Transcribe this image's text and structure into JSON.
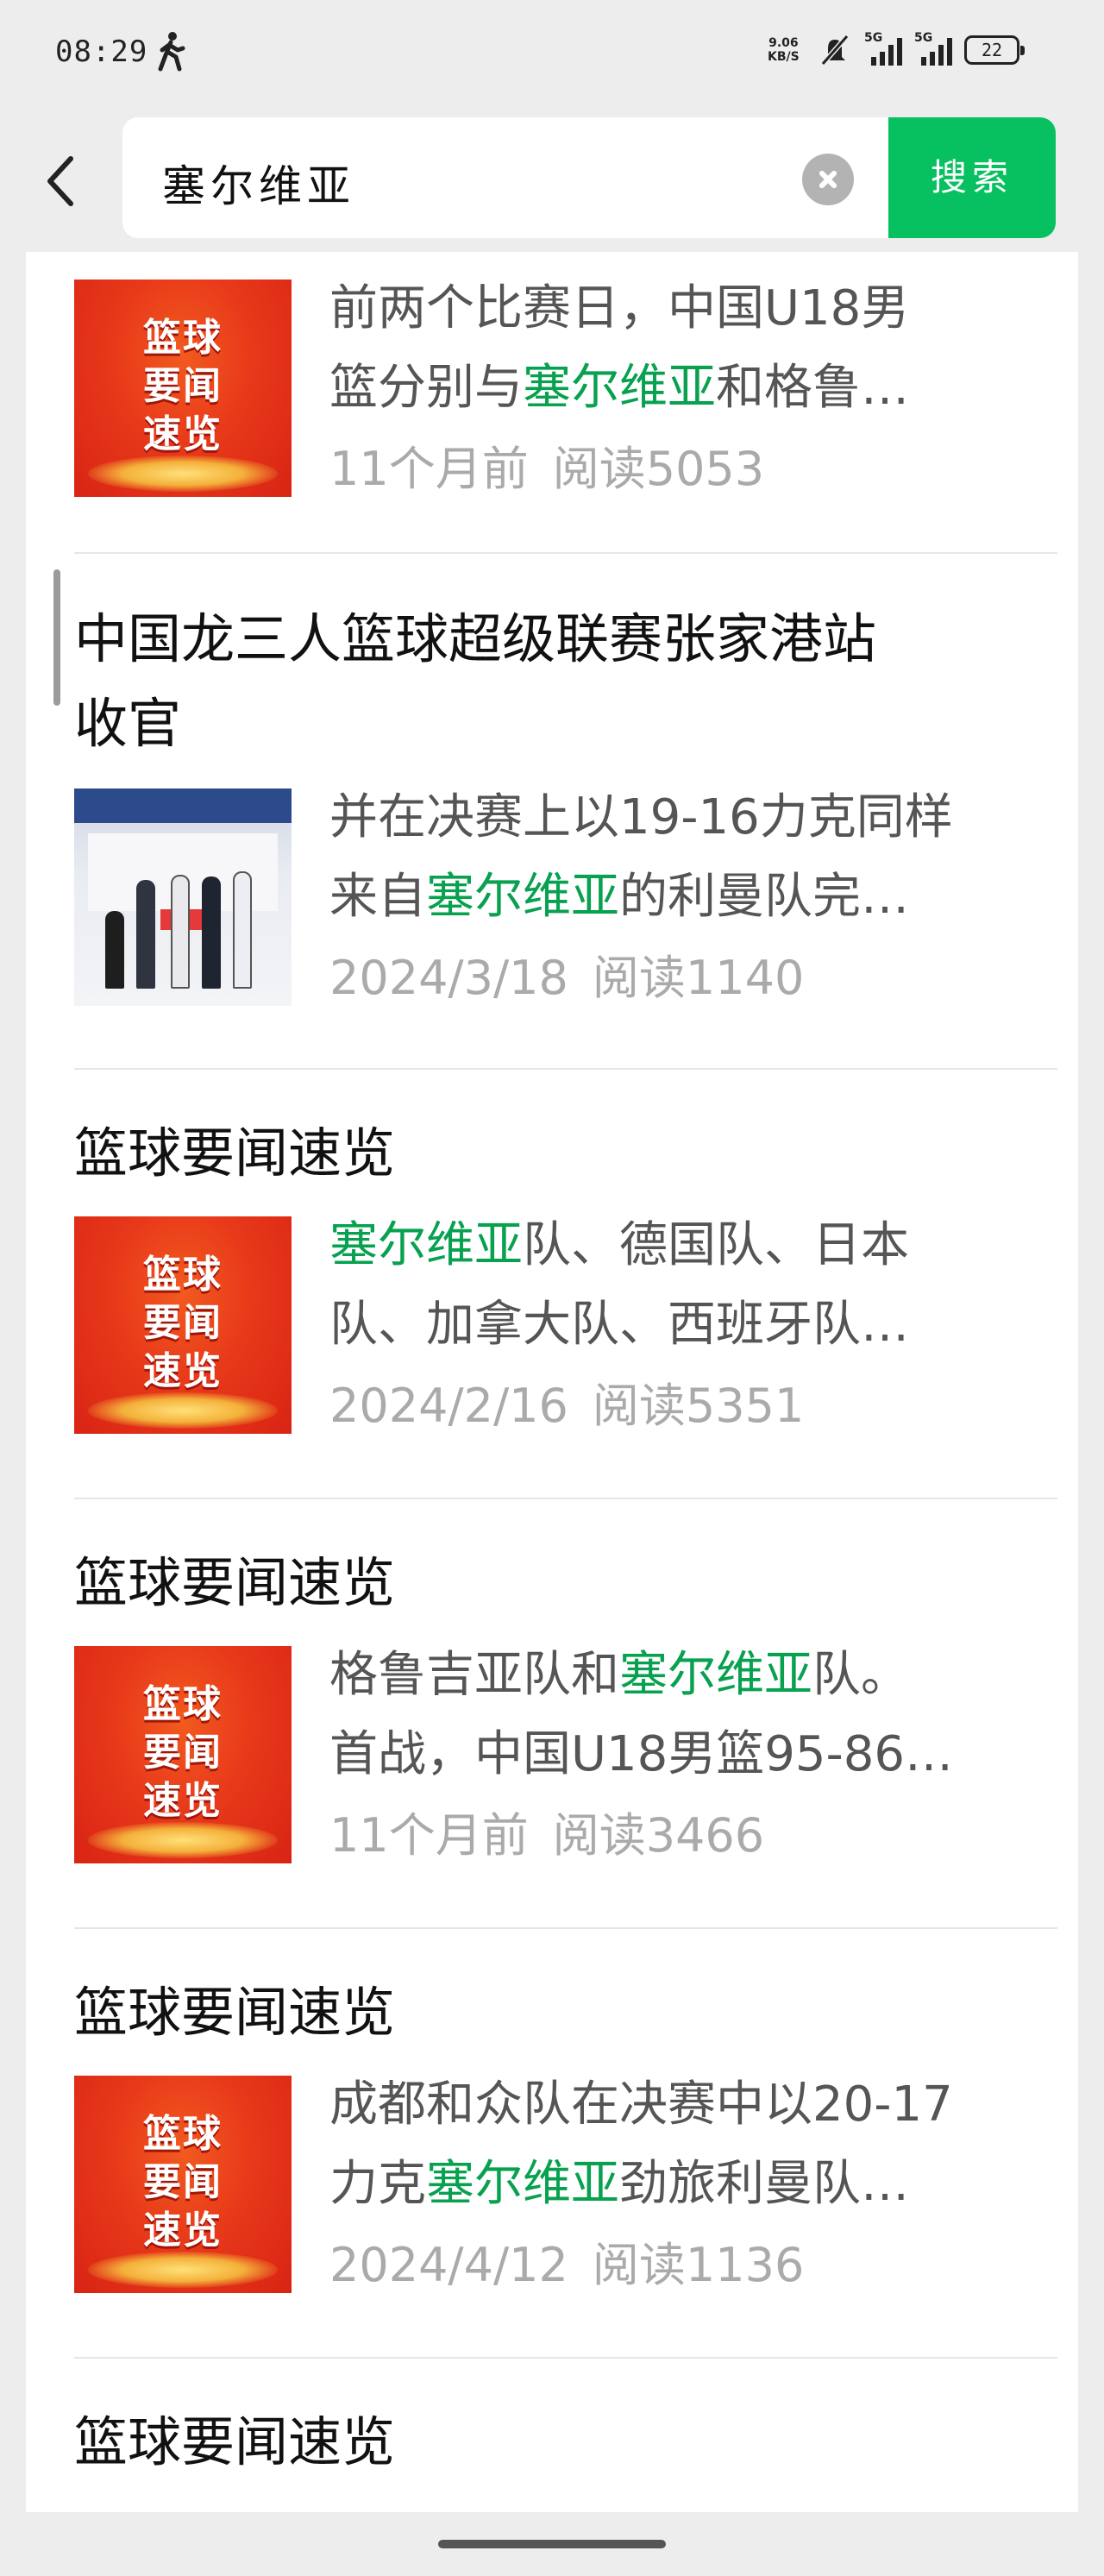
{
  "status_bar": {
    "time": "08:29",
    "net_speed_value": "9.06",
    "net_speed_unit": "KB/S",
    "signal1_label": "5G",
    "signal2_label": "5G",
    "battery": "22"
  },
  "search": {
    "query": "塞尔维亚",
    "button_label": "搜索"
  },
  "colors": {
    "accent": "#07c160",
    "highlight": "#07a14f",
    "thumb_red": "#e8391a"
  },
  "results": [
    {
      "title": "",
      "thumb_type": "red",
      "thumb_lines": [
        "篮球",
        "要闻",
        "速览"
      ],
      "desc_line1": [
        {
          "text": "前两个比赛日，中国U18男",
          "hl": false
        }
      ],
      "desc_line2": [
        {
          "text": "篮分别与",
          "hl": false
        },
        {
          "text": "塞尔维亚",
          "hl": true
        },
        {
          "text": "和格鲁…",
          "hl": false
        }
      ],
      "date": "11个月前",
      "reads": "阅读5053"
    },
    {
      "title_line1": "中国龙三人篮球超级联赛张家港站",
      "title_line2": "收官",
      "thumb_type": "photo",
      "desc_line1": [
        {
          "text": "并在决赛上以19-16力克同样",
          "hl": false
        }
      ],
      "desc_line2": [
        {
          "text": "来自",
          "hl": false
        },
        {
          "text": "塞尔维亚",
          "hl": true
        },
        {
          "text": "的利曼队完…",
          "hl": false
        }
      ],
      "date": "2024/3/18",
      "reads": "阅读1140"
    },
    {
      "title": "篮球要闻速览",
      "thumb_type": "red",
      "thumb_lines": [
        "篮球",
        "要闻",
        "速览"
      ],
      "desc_line1": [
        {
          "text": "塞尔维亚",
          "hl": true
        },
        {
          "text": "队、德国队、日本",
          "hl": false
        }
      ],
      "desc_line2": [
        {
          "text": "队、加拿大队、西班牙队…",
          "hl": false
        }
      ],
      "date": "2024/2/16",
      "reads": "阅读5351"
    },
    {
      "title": "篮球要闻速览",
      "thumb_type": "red",
      "thumb_lines": [
        "篮球",
        "要闻",
        "速览"
      ],
      "desc_line1": [
        {
          "text": "格鲁吉亚队和",
          "hl": false
        },
        {
          "text": "塞尔维亚",
          "hl": true
        },
        {
          "text": "队。",
          "hl": false
        }
      ],
      "desc_line2": [
        {
          "text": "首战，中国U18男篮95-86…",
          "hl": false
        }
      ],
      "date": "11个月前",
      "reads": "阅读3466"
    },
    {
      "title": "篮球要闻速览",
      "thumb_type": "red",
      "thumb_lines": [
        "篮球",
        "要闻",
        "速览"
      ],
      "desc_line1": [
        {
          "text": "成都和众队在决赛中以20-17",
          "hl": false
        }
      ],
      "desc_line2": [
        {
          "text": "力克",
          "hl": false
        },
        {
          "text": "塞尔维亚",
          "hl": true
        },
        {
          "text": "劲旅利曼队…",
          "hl": false
        }
      ],
      "date": "2024/4/12",
      "reads": "阅读1136"
    },
    {
      "title": "篮球要闻速览"
    }
  ]
}
